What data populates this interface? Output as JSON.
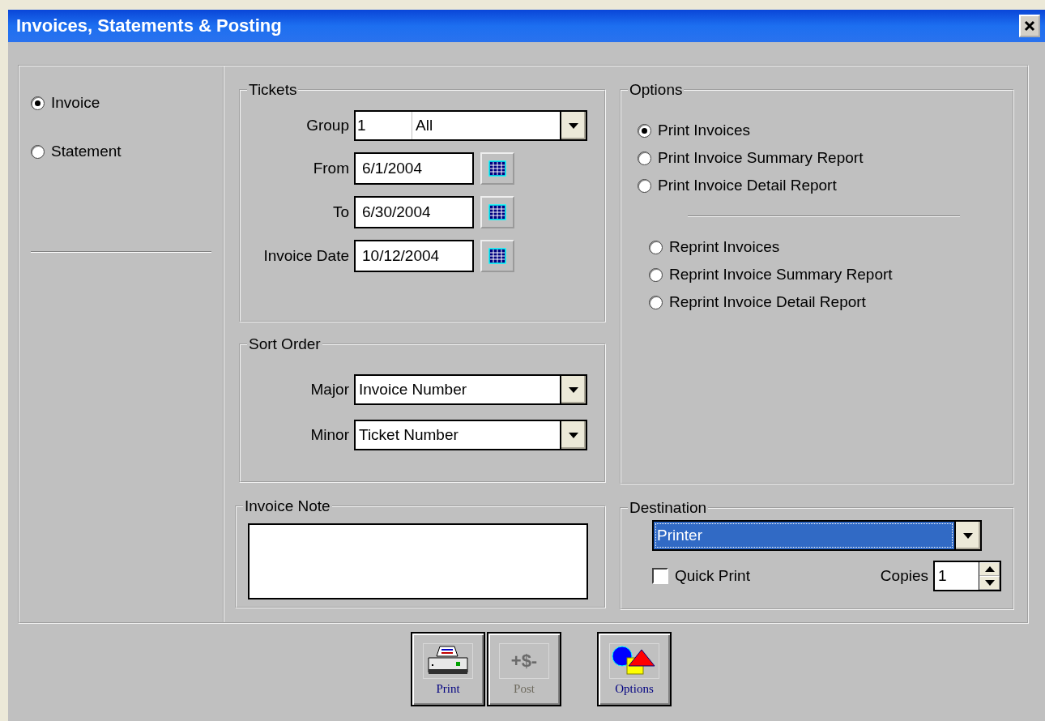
{
  "window": {
    "title": "Invoices, Statements & Posting"
  },
  "mode_options": [
    {
      "label": "Invoice",
      "selected": true
    },
    {
      "label": "Statement",
      "selected": false
    }
  ],
  "tickets": {
    "title": "Tickets",
    "group": {
      "label": "Group",
      "code": "1",
      "value": "All"
    },
    "dates": [
      {
        "label": "From",
        "value": "6/1/2004"
      },
      {
        "label": "To",
        "value": "6/30/2004"
      },
      {
        "label": "Invoice Date",
        "value": "10/12/2004"
      }
    ]
  },
  "sort_order": {
    "title": "Sort Order",
    "fields": [
      {
        "label": "Major",
        "value": "Invoice Number"
      },
      {
        "label": "Minor",
        "value": "Ticket Number"
      }
    ]
  },
  "invoice_note": {
    "title": "Invoice Note"
  },
  "options": {
    "title": "Options",
    "print_options": [
      {
        "label": "Print Invoices",
        "selected": true
      },
      {
        "label": "Print Invoice Summary Report",
        "selected": false
      },
      {
        "label": "Print Invoice Detail Report",
        "selected": false
      }
    ],
    "reprint_options": [
      {
        "label": "Reprint Invoices",
        "selected": false
      },
      {
        "label": "Reprint Invoice Summary Report",
        "selected": false
      },
      {
        "label": "Reprint Invoice Detail Report",
        "selected": false
      }
    ]
  },
  "destination": {
    "title": "Destination",
    "value": "Printer",
    "quick_print": {
      "label": "Quick Print",
      "checked": false
    },
    "copies": {
      "label": "Copies",
      "value": "1"
    }
  },
  "buttons": [
    {
      "kind": "print",
      "label": "Print",
      "disabled": false
    },
    {
      "kind": "post",
      "label": "Post",
      "icon_text": "+$-",
      "disabled": true
    },
    {
      "kind": "options",
      "label": "Options",
      "disabled": false
    }
  ]
}
